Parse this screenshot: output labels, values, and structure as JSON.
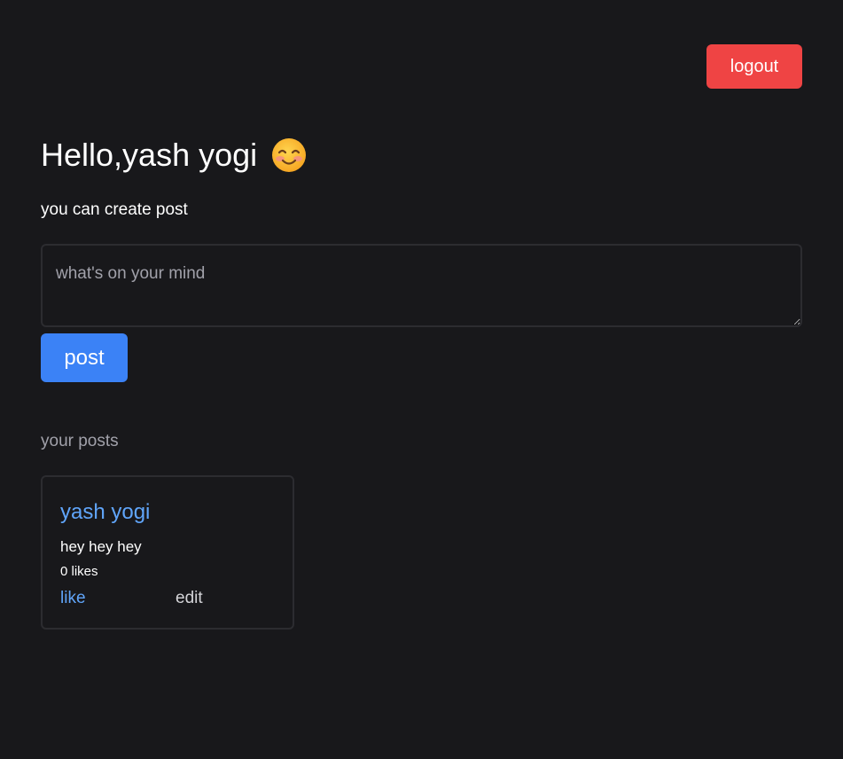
{
  "header": {
    "logout_label": "logout"
  },
  "greeting": {
    "hello": "Hello,",
    "name": "yash yogi",
    "emoji": "smiling-face-with-smiling-eyes-icon"
  },
  "create": {
    "subtitle": "you can create post",
    "placeholder": "what's on your mind",
    "value": "",
    "post_label": "post"
  },
  "posts": {
    "section_title": "your posts",
    "items": [
      {
        "author": "yash yogi",
        "content": "hey hey hey",
        "likes": "0 likes",
        "like_label": "like",
        "edit_label": "edit"
      }
    ]
  },
  "colors": {
    "background": "#18181b",
    "danger": "#ef4444",
    "primary": "#3b82f6",
    "link": "#60a5fa",
    "muted": "#a1a1aa",
    "border": "#2c2c30"
  }
}
